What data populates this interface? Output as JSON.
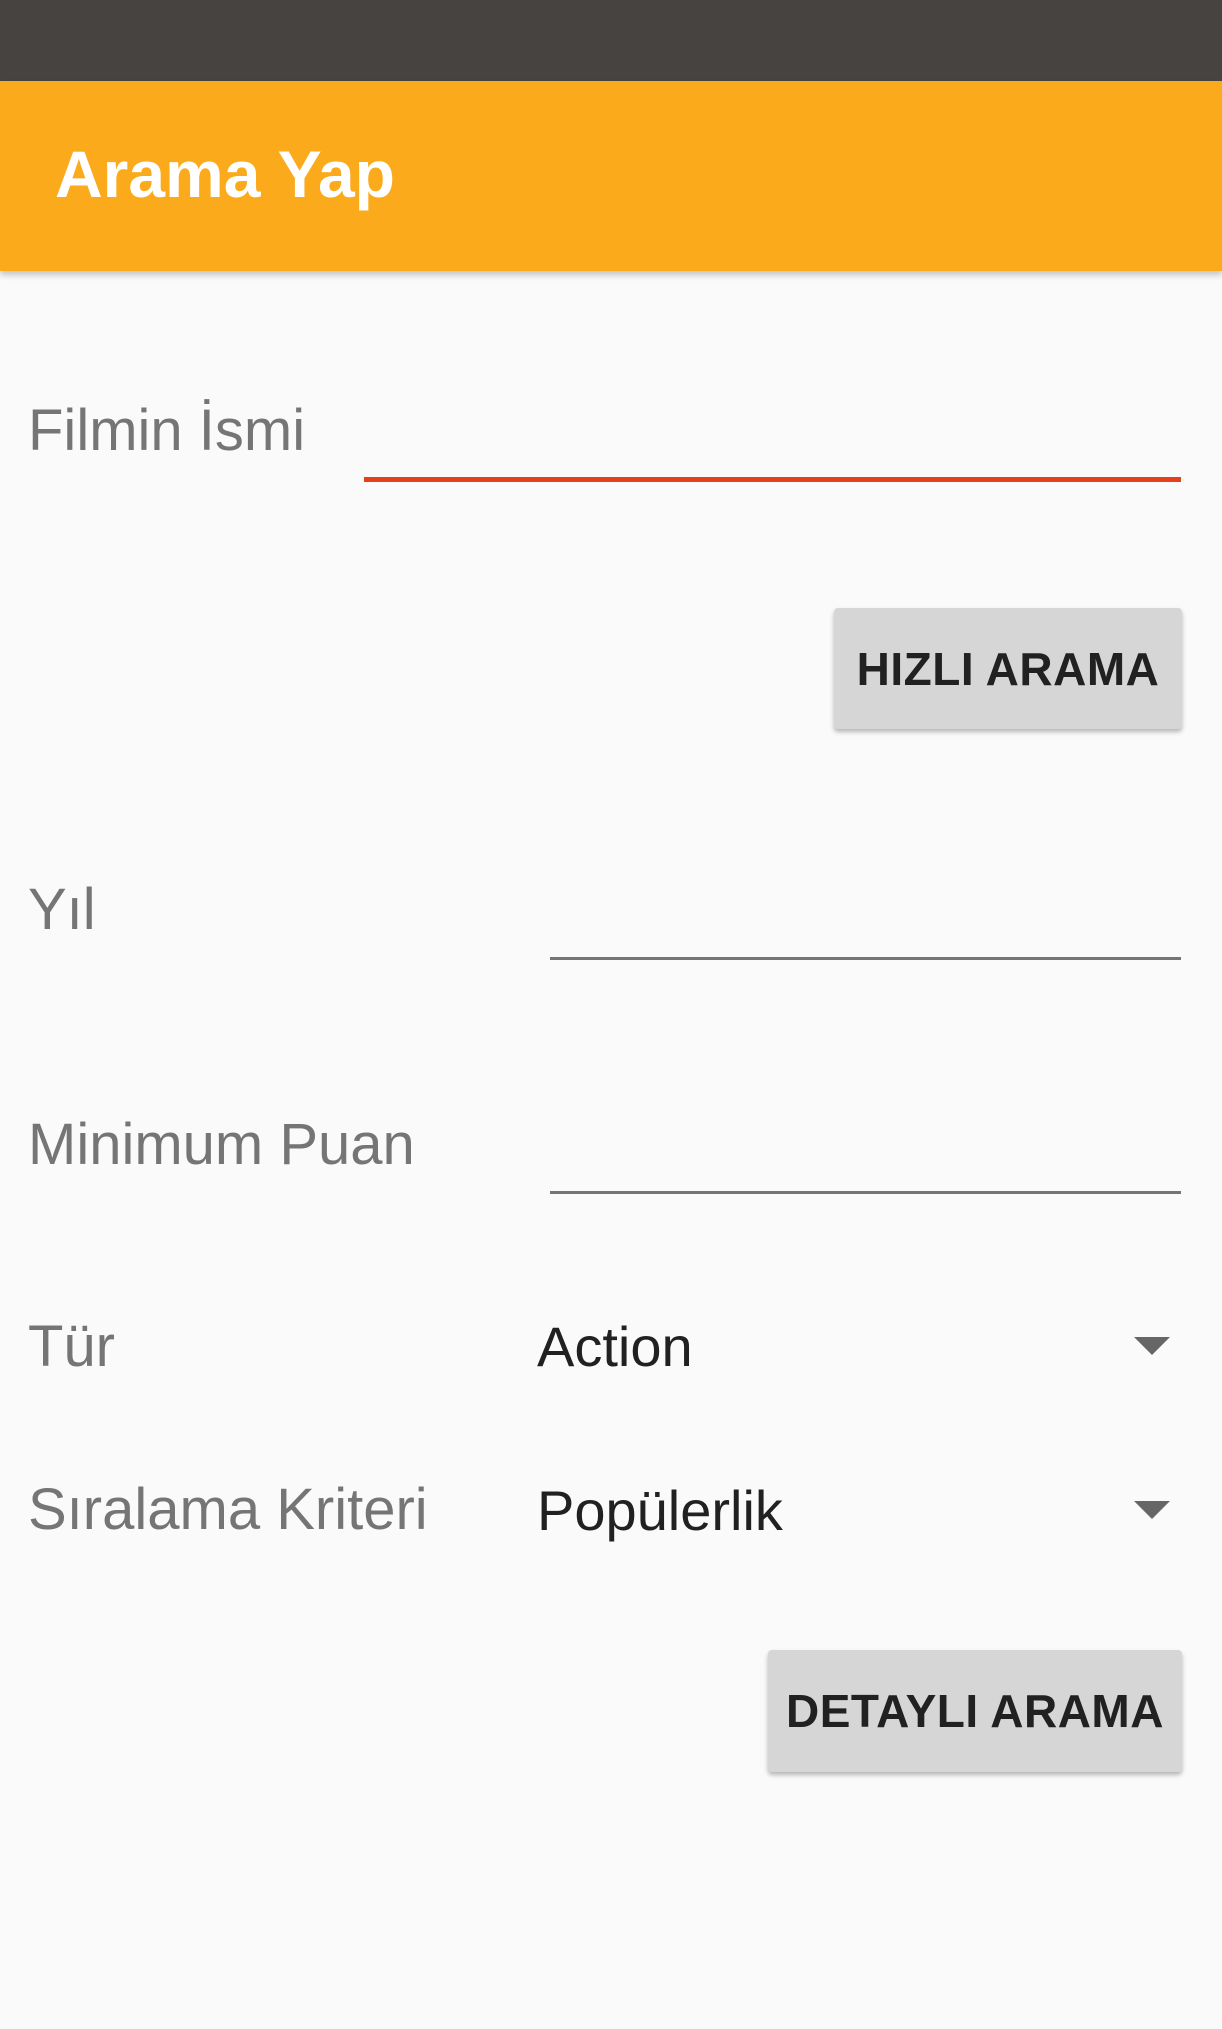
{
  "app_bar": {
    "title": "Arama Yap"
  },
  "form": {
    "film_name": {
      "label": "Filmin İsmi",
      "value": "",
      "focused": true
    },
    "quick_search_label": "HIZLI ARAMA",
    "year": {
      "label": "Yıl",
      "value": ""
    },
    "min_rating": {
      "label": "Minimum Puan",
      "value": ""
    },
    "genre": {
      "label": "Tür",
      "selected": "Action"
    },
    "sort": {
      "label": "Sıralama Kriteri",
      "selected": "Popülerlik"
    },
    "detailed_search_label": "DETAYLI ARAMA"
  },
  "colors": {
    "status_bar": "#464340",
    "app_bar": "#fbaa1b",
    "accent": "#e4411b",
    "background": "#fafafa",
    "button": "#d6d6d6"
  },
  "icons": {
    "dropdown": "triangle-down-icon"
  }
}
